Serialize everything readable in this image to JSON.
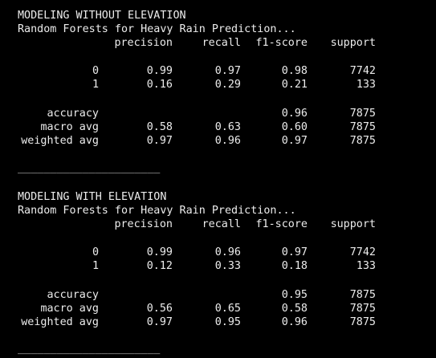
{
  "sections": [
    {
      "title": "MODELING WITHOUT ELEVATION",
      "subtitle": "Random Forests for Heavy Rain Prediction...",
      "headers": {
        "precision": "precision",
        "recall": "recall",
        "f1": "f1-score",
        "support": "support"
      },
      "classes": [
        {
          "label": "0",
          "precision": "0.99",
          "recall": "0.97",
          "f1": "0.98",
          "support": "7742"
        },
        {
          "label": "1",
          "precision": "0.16",
          "recall": "0.29",
          "f1": "0.21",
          "support": "133"
        }
      ],
      "summary": [
        {
          "label": "accuracy",
          "precision": "",
          "recall": "",
          "f1": "0.96",
          "support": "7875"
        },
        {
          "label": "macro avg",
          "precision": "0.58",
          "recall": "0.63",
          "f1": "0.60",
          "support": "7875"
        },
        {
          "label": "weighted avg",
          "precision": "0.97",
          "recall": "0.96",
          "f1": "0.97",
          "support": "7875"
        }
      ],
      "rule": "______________________"
    },
    {
      "title": "MODELING WITH ELEVATION",
      "subtitle": "Random Forests for Heavy Rain Prediction...",
      "headers": {
        "precision": "precision",
        "recall": "recall",
        "f1": "f1-score",
        "support": "support"
      },
      "classes": [
        {
          "label": "0",
          "precision": "0.99",
          "recall": "0.96",
          "f1": "0.97",
          "support": "7742"
        },
        {
          "label": "1",
          "precision": "0.12",
          "recall": "0.33",
          "f1": "0.18",
          "support": "133"
        }
      ],
      "summary": [
        {
          "label": "accuracy",
          "precision": "",
          "recall": "",
          "f1": "0.95",
          "support": "7875"
        },
        {
          "label": "macro avg",
          "precision": "0.56",
          "recall": "0.65",
          "f1": "0.58",
          "support": "7875"
        },
        {
          "label": "weighted avg",
          "precision": "0.97",
          "recall": "0.95",
          "f1": "0.96",
          "support": "7875"
        }
      ],
      "rule": "______________________"
    }
  ],
  "colors": {
    "background": "#000000",
    "text": "#ececec"
  }
}
